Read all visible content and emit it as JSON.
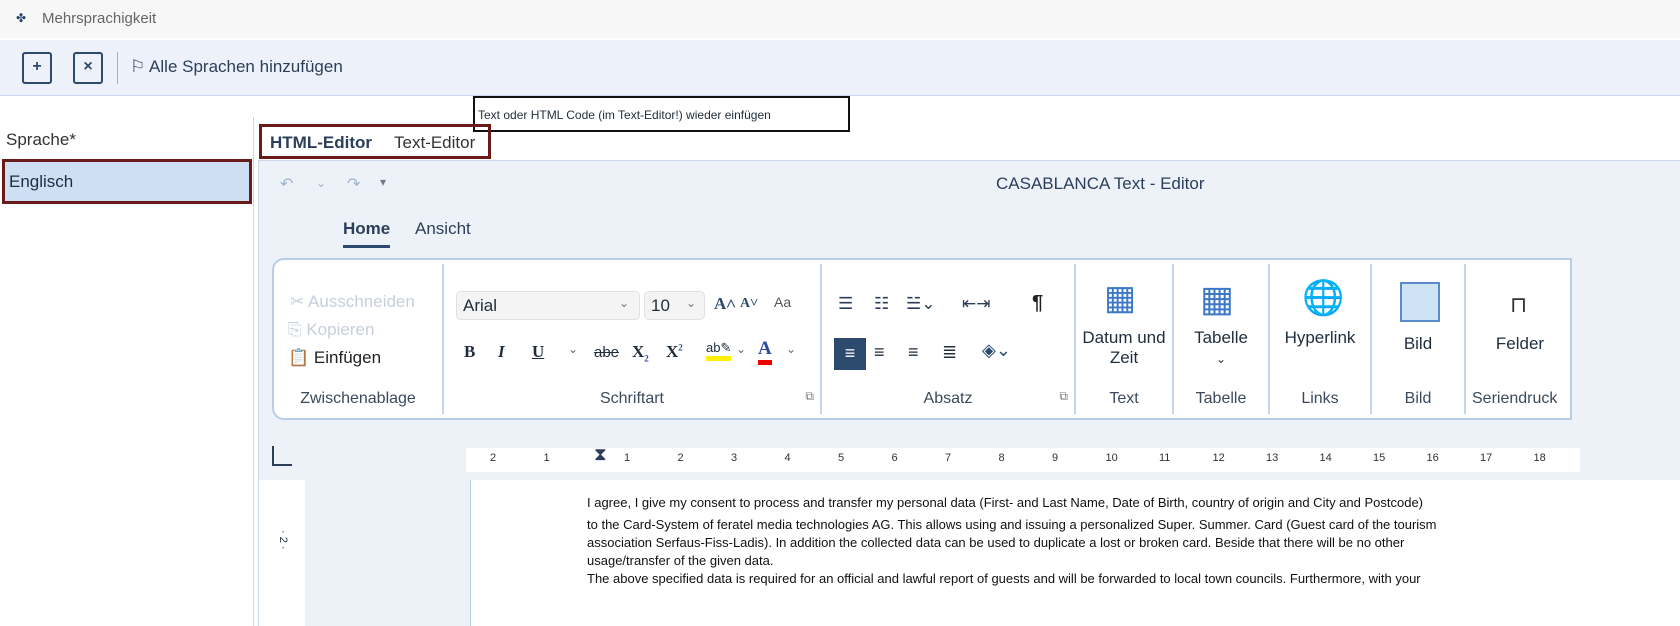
{
  "window": {
    "title": "Mehrsprachigkeit"
  },
  "toolbar": {
    "add_label": "Alle Sprachen hinzufügen"
  },
  "tooltip": "Text oder HTML Code (im Text-Editor!) wieder einfügen",
  "left": {
    "header": "Sprache*",
    "items": [
      "Englisch"
    ]
  },
  "editor_tabs": [
    "HTML-Editor",
    "Text-Editor"
  ],
  "editor": {
    "title": "CASABLANCA Text - Editor",
    "ribbon_tabs": [
      "Home",
      "Ansicht"
    ],
    "clipboard": {
      "cut": "Ausschneiden",
      "copy": "Kopieren",
      "paste": "Einfügen",
      "label": "Zwischenablage"
    },
    "font": {
      "name": "Arial",
      "size": "10",
      "label": "Schriftart"
    },
    "paragraph": {
      "label": "Absatz"
    },
    "text": {
      "button": "Datum und Zeit",
      "label": "Text"
    },
    "table": {
      "button": "Tabelle",
      "label": "Tabelle"
    },
    "links": {
      "button": "Hyperlink",
      "label": "Links"
    },
    "image": {
      "button": "Bild",
      "label": "Bild"
    },
    "mail": {
      "button": "Felder",
      "label": "Seriendruck"
    }
  },
  "ruler": [
    "2",
    "1",
    "1",
    "2",
    "3",
    "4",
    "5",
    "6",
    "7",
    "8",
    "9",
    "10",
    "11",
    "12",
    "13",
    "14",
    "15",
    "16",
    "17",
    "18"
  ],
  "document": {
    "lines": [
      " I agree, I give my consent to process and transfer my personal data (First- and Last Name, Date of Birth, country of origin and City and Postcode)",
      "to the Card-System of feratel media technologies AG. This allows using and issuing a personalized Super. Summer. Card (Guest card of the tourism",
      "association Serfaus-Fiss-Ladis). In addition the collected data can be used to duplicate a lost or broken card. Beside that there will be no other",
      "usage/transfer of the given data.",
      "The above specified data is required for an official and lawful report of guests and will be forwarded to local town councils. Furthermore, with your"
    ]
  }
}
